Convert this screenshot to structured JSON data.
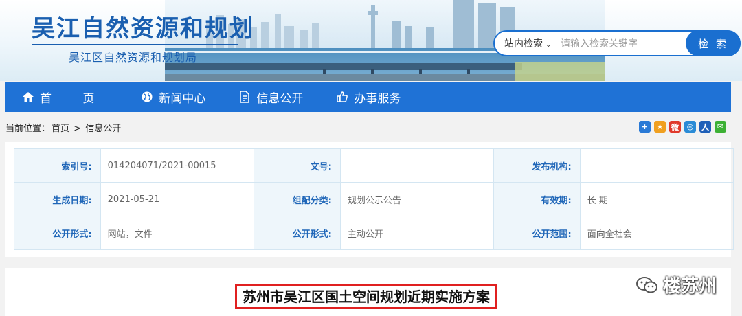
{
  "header": {
    "title": "吴江自然资源和规划",
    "subtitle": "吴江区自然资源和规划局"
  },
  "search": {
    "scope": "站内检索",
    "placeholder": "请输入检索关键字",
    "button": "检 索"
  },
  "nav": [
    {
      "label": "首 页",
      "icon": "home-icon"
    },
    {
      "label": "新闻中心",
      "icon": "globe-icon"
    },
    {
      "label": "信息公开",
      "icon": "document-icon"
    },
    {
      "label": "办事服务",
      "icon": "thumbs-up-icon"
    }
  ],
  "breadcrumb": {
    "prefix": "当前位置：",
    "home": "首页",
    "sep": ">",
    "current": "信息公开"
  },
  "share_icons": [
    {
      "name": "add-share-icon",
      "color": "#2a7ad6",
      "glyph": "+"
    },
    {
      "name": "qzone-icon",
      "color": "#f0a020",
      "glyph": "★"
    },
    {
      "name": "weibo-icon",
      "color": "#e0392b",
      "glyph": "微"
    },
    {
      "name": "tencent-weibo-icon",
      "color": "#2a8bd6",
      "glyph": "◎"
    },
    {
      "name": "renren-icon",
      "color": "#1f5fb8",
      "glyph": "人"
    },
    {
      "name": "wechat-icon",
      "color": "#3cb034",
      "glyph": "✉"
    }
  ],
  "info": {
    "row1": {
      "k1": "索引号:",
      "v1": "014204071/2021-00015",
      "k2": "文号:",
      "v2": "",
      "k3": "发布机构:",
      "v3": ""
    },
    "row2": {
      "k1": "生成日期:",
      "v1": "2021-05-21",
      "k2": "组配分类:",
      "v2": "规划公示公告",
      "k3": "有效期:",
      "v3": "长 期"
    },
    "row3": {
      "k1": "公开形式:",
      "v1": "网站，文件",
      "k2": "公开形式:",
      "v2": "主动公开",
      "k3": "公开范围:",
      "v3": "面向全社会"
    }
  },
  "article": {
    "title": "苏州市吴江区国土空间规划近期实施方案"
  },
  "watermark": {
    "text": "楼苏州"
  }
}
